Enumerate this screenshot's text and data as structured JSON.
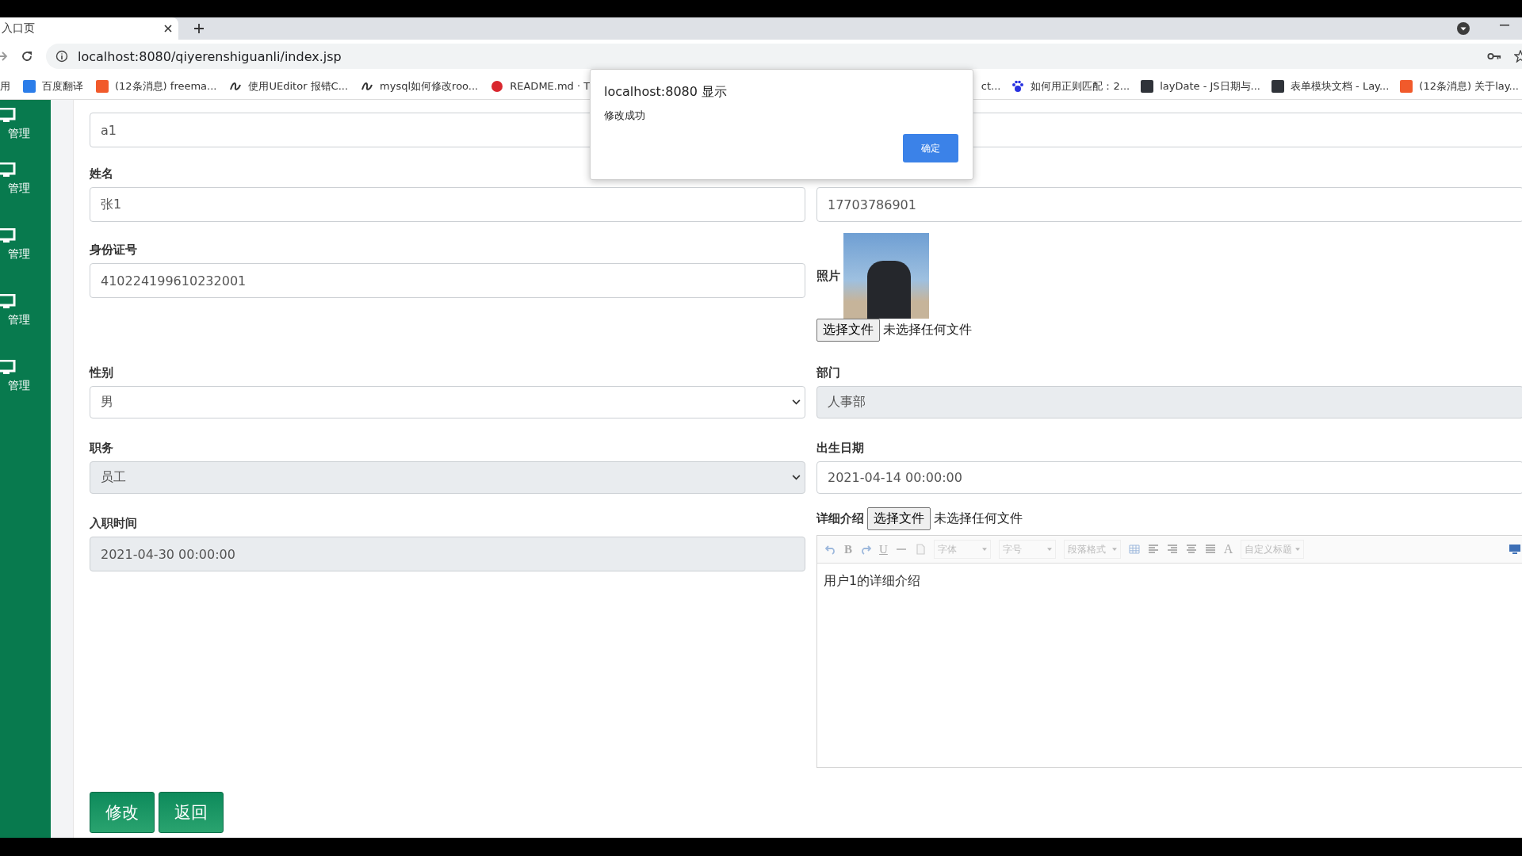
{
  "browser": {
    "tab": {
      "title": "入口页"
    },
    "url": "localhost:8080/qiyerenshiguanli/index.jsp",
    "bookmarks_left": [
      {
        "text": "用",
        "kind": "none"
      },
      {
        "text": "百度翻译",
        "kind": "bluesquare"
      },
      {
        "text": "(12条消息) freema...",
        "kind": "orangesquare"
      },
      {
        "text": "使用UEditor 报错C...",
        "kind": "swirl"
      },
      {
        "text": "mysql如何修改roo...",
        "kind": "swirl"
      },
      {
        "text": "README.md · T",
        "kind": "circle"
      }
    ],
    "bookmarks_right": [
      {
        "text": "ct...",
        "kind": "none"
      },
      {
        "text": "如何用正则匹配：2...",
        "kind": "paw"
      },
      {
        "text": "layDate - JS日期与...",
        "kind": "darksquare"
      },
      {
        "text": "表单模块文档 - Lay...",
        "kind": "darksquare"
      },
      {
        "text": "(12条消息) 关于lay...",
        "kind": "orangesquare"
      }
    ]
  },
  "sidebar": {
    "items": [
      {
        "label": "管理"
      },
      {
        "label": "管理"
      },
      {
        "label": "管理"
      },
      {
        "label": "管理"
      },
      {
        "label": "管理"
      }
    ]
  },
  "form": {
    "account_value": "a1",
    "name": {
      "label": "姓名",
      "value": "张1"
    },
    "phone_value": "17703786901",
    "id_number": {
      "label": "身份证号",
      "value": "410224199610232001"
    },
    "photo": {
      "label": "照片",
      "file_button": "选择文件",
      "file_status": "未选择任何文件"
    },
    "gender": {
      "label": "性别",
      "value": "男",
      "disabled": false
    },
    "department": {
      "label": "部门",
      "value": "人事部",
      "disabled": true
    },
    "position": {
      "label": "职务",
      "value": "员工",
      "disabled": true
    },
    "birth_date": {
      "label": "出生日期",
      "value": "2021-04-14 00:00:00",
      "disabled": false
    },
    "hire_date": {
      "label": "入职时间",
      "value": "2021-04-30 00:00:00",
      "disabled": true
    },
    "details": {
      "label": "详细介绍",
      "file_button": "选择文件",
      "file_status": "未选择任何文件",
      "toolbar_glyphs": [
        "B",
        "U",
        "A"
      ],
      "dropdowns": [
        "字体",
        "字号",
        "段落格式",
        "自定义标题"
      ],
      "content": "用户1的详细介绍"
    },
    "buttons": [
      "修改",
      "返回"
    ]
  },
  "dialog": {
    "title": "localhost:8080 显示",
    "message": "修改成功",
    "button": "确定"
  }
}
